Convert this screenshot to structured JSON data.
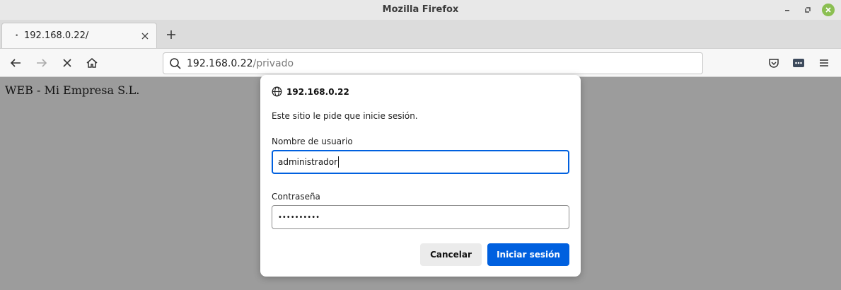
{
  "window": {
    "title": "Mozilla Firefox"
  },
  "tabs": [
    {
      "label": "192.168.0.22/",
      "loading_indicator": "•"
    }
  ],
  "navbar": {
    "url_host": "192.168.0.22",
    "url_path": "/privado"
  },
  "page": {
    "text": "WEB - Mi Empresa S.L."
  },
  "dialog": {
    "host": "192.168.0.22",
    "message": "Este sitio le pide que inicie sesión.",
    "username_label": "Nombre de usuario",
    "username_value": "administrador",
    "password_label": "Contraseña",
    "password_value": "••••••••••",
    "cancel_label": "Cancelar",
    "submit_label": "Iniciar sesión"
  },
  "colors": {
    "accent": "#0060df",
    "overlay": "#9c9c9c",
    "close_button": "#8bbf52"
  }
}
